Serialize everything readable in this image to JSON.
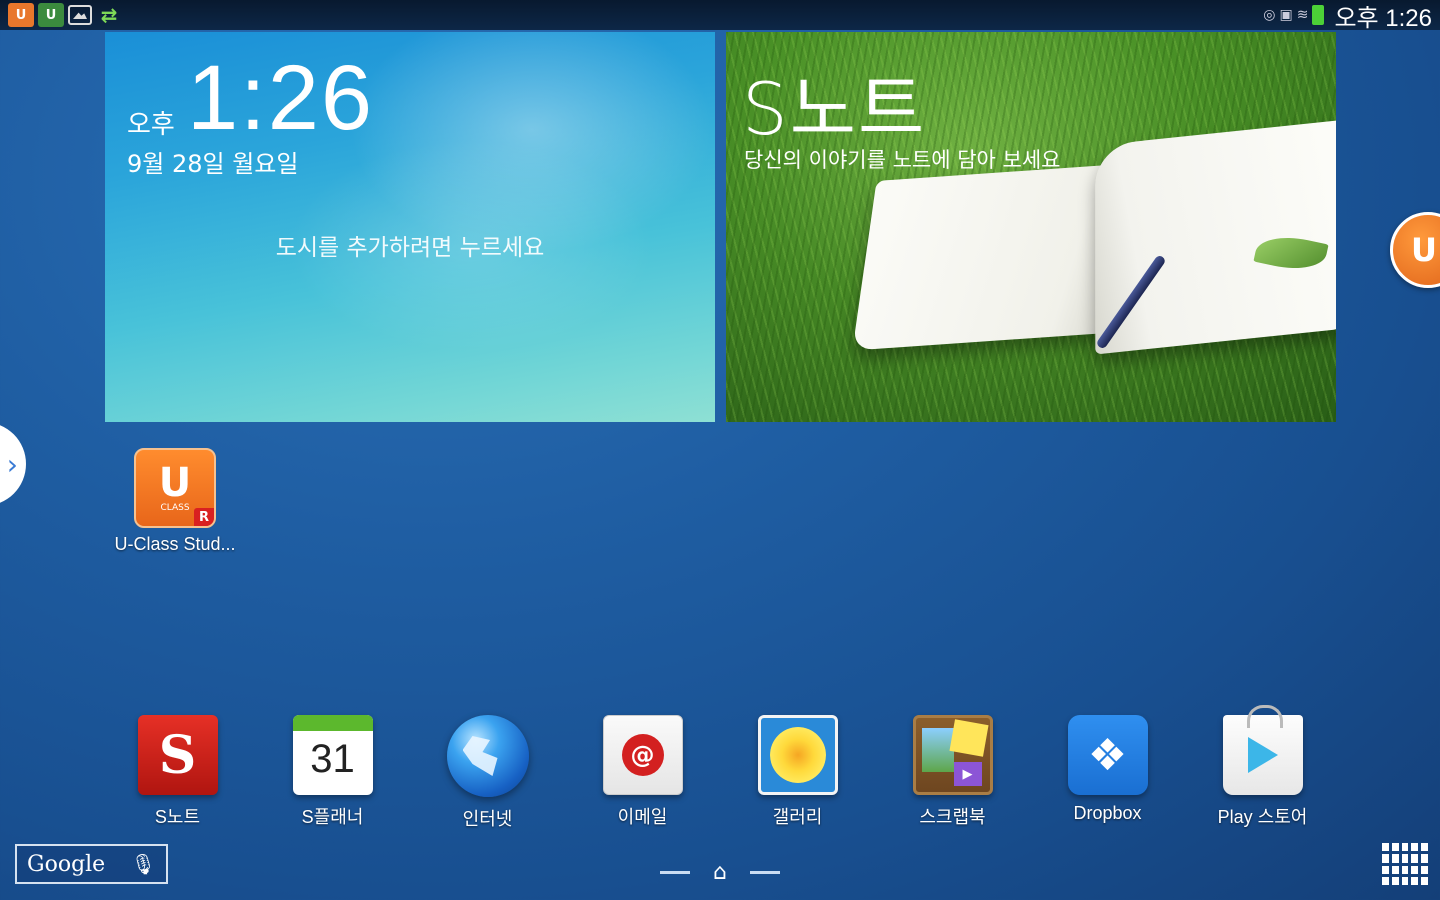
{
  "status_bar": {
    "left_icons": [
      {
        "name": "uclass-notification-icon",
        "glyph": "U"
      },
      {
        "name": "uclass-notification-icon-2",
        "glyph": "U"
      },
      {
        "name": "gallery-notification-icon",
        "glyph": ""
      },
      {
        "name": "charging-icon",
        "glyph": "⇄"
      }
    ],
    "time": "오후 1:26"
  },
  "weather_widget": {
    "ampm": "오후",
    "time": "1:26",
    "date": "9월 28일 월요일",
    "prompt": "도시를 추가하려면 누르세요"
  },
  "snote_widget": {
    "title": "S노트",
    "subtitle": "당신의 이야기를 노트에 담아 보세요"
  },
  "desktop_apps": [
    {
      "label": "U-Class Stud...",
      "icon": "uclass-icon",
      "badge": "R",
      "icon_text": "U",
      "icon_sub": "CLASS"
    }
  ],
  "floating_bubble": {
    "text": "U"
  },
  "dock_apps": [
    {
      "label": "S노트",
      "icon": "snote-icon",
      "glyph": "S"
    },
    {
      "label": "S플래너",
      "icon": "calendar-icon",
      "glyph": "31"
    },
    {
      "label": "인터넷",
      "icon": "globe-icon",
      "glyph": ""
    },
    {
      "label": "이메일",
      "icon": "email-icon",
      "glyph": "@"
    },
    {
      "label": "갤러리",
      "icon": "gallery-icon",
      "glyph": ""
    },
    {
      "label": "스크랩북",
      "icon": "scrapbook-icon",
      "glyph": "▶"
    },
    {
      "label": "Dropbox",
      "icon": "dropbox-icon",
      "glyph": "❖"
    },
    {
      "label": "Play 스토어",
      "icon": "play-store-icon",
      "glyph": ""
    }
  ],
  "search_bar": {
    "label": "Google",
    "mic": "🎙"
  },
  "nav": {
    "home_glyph": "⌂"
  },
  "side_handle": {
    "glyph": "›"
  }
}
